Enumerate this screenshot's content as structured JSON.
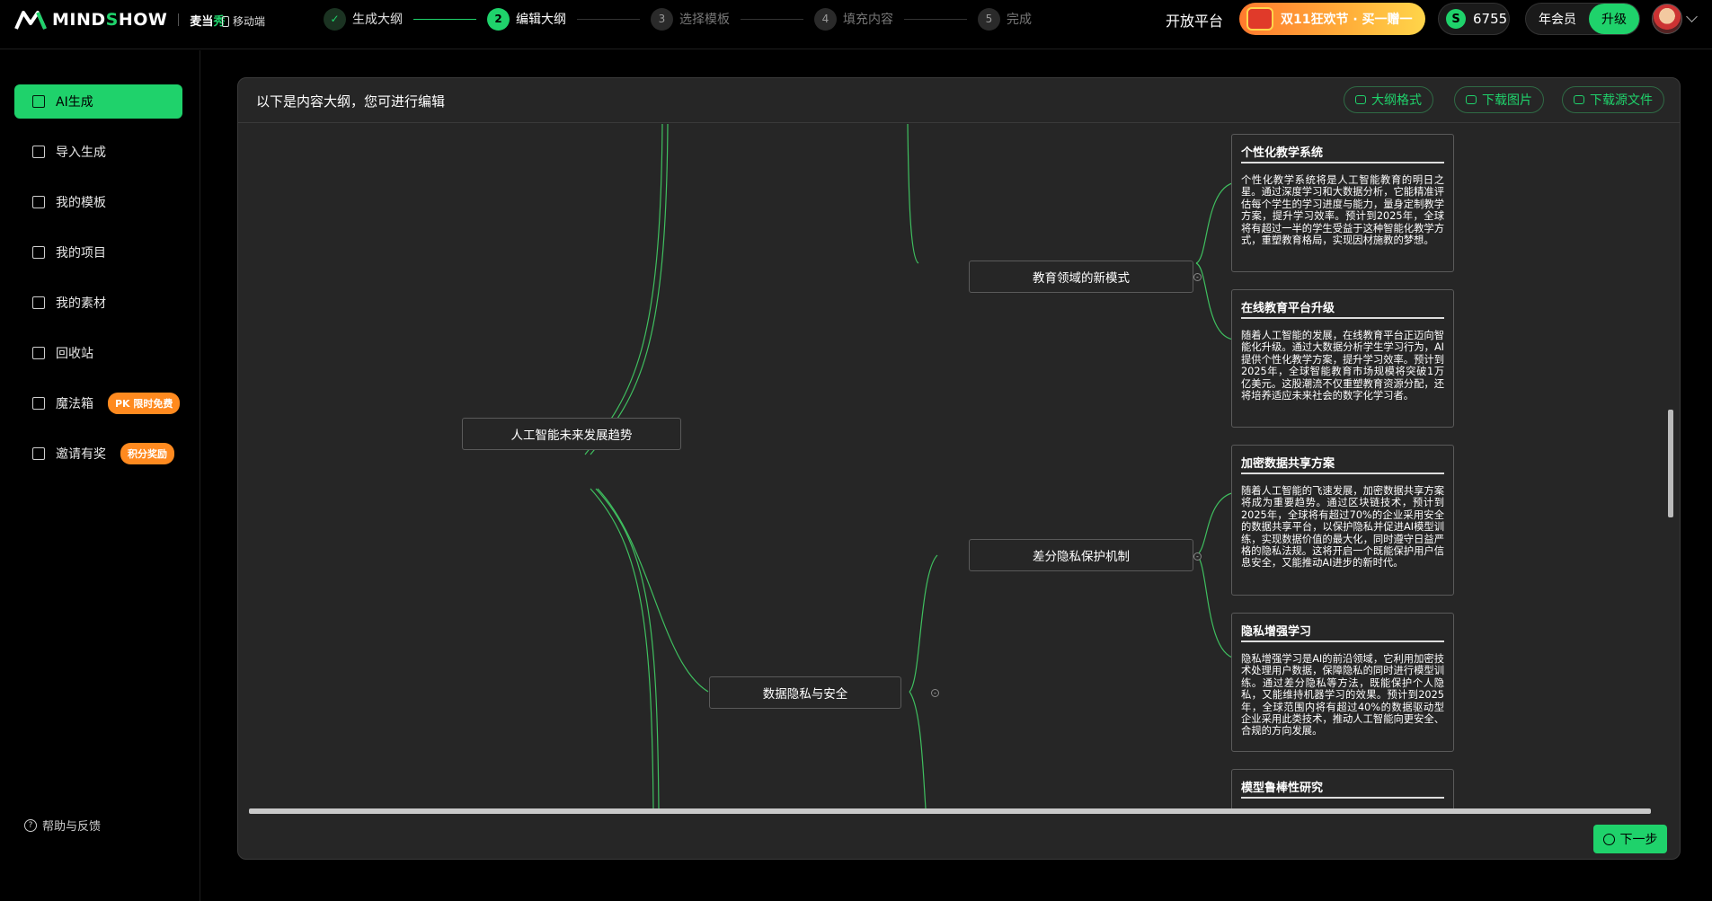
{
  "brand": {
    "logo_text_prefix": "MIND",
    "logo_text_s": "S",
    "logo_text_suffix": "HOW",
    "partner_a": "麦当",
    "partner_b": "秀",
    "mobile": "移动端"
  },
  "steps": [
    {
      "num": "✓",
      "label": "生成大纲",
      "state": "done"
    },
    {
      "num": "2",
      "label": "编辑大纲",
      "state": "active"
    },
    {
      "num": "3",
      "label": "选择模板",
      "state": "todo"
    },
    {
      "num": "4",
      "label": "填充内容",
      "state": "todo"
    },
    {
      "num": "5",
      "label": "完成",
      "state": "todo"
    }
  ],
  "header": {
    "open_platform": "开放平台",
    "promo": "双11狂欢节 · 买一赠一",
    "coin_symbol": "S",
    "coins": "6755",
    "member_label": "年会员",
    "upgrade": "升级"
  },
  "sidebar": {
    "items": [
      {
        "label": "AI生成",
        "icon": "ai-icon",
        "active": true
      },
      {
        "label": "导入生成",
        "icon": "import-icon"
      },
      {
        "label": "我的模板",
        "icon": "template-icon"
      },
      {
        "label": "我的项目",
        "icon": "list-icon"
      },
      {
        "label": "我的素材",
        "icon": "folder-icon"
      },
      {
        "label": "回收站",
        "icon": "trash-icon"
      },
      {
        "label": "魔法箱",
        "icon": "magic-wand-icon",
        "badge": "PK 限时免费"
      },
      {
        "label": "邀请有奖",
        "icon": "invite-icon",
        "badge": "积分奖励"
      }
    ],
    "help": "帮助与反馈"
  },
  "panel": {
    "title": "以下是内容大纲，您可进行编辑",
    "outline_format": "大纲格式",
    "download_image": "下载图片",
    "download_source": "下载源文件",
    "next": "下一步"
  },
  "mindmap": {
    "root": "人工智能未来发展趋势",
    "branch": "数据隐私与安全",
    "sub_edu": "教育领域的新模式",
    "sub_privacy": "差分隐私保护机制",
    "cards": [
      {
        "title": "个性化教学系统",
        "body": "个性化教学系统将是人工智能教育的明日之星。通过深度学习和大数据分析，它能精准评估每个学生的学习进度与能力，量身定制教学方案，提升学习效率。预计到2025年，全球将有超过一半的学生受益于这种智能化教学方式，重塑教育格局，实现因材施教的梦想。"
      },
      {
        "title": "在线教育平台升级",
        "body": "随着人工智能的发展，在线教育平台正迈向智能化升级。通过大数据分析学生学习行为，AI提供个性化教学方案，提升学习效率。预计到2025年，全球智能教育市场规模将突破1万亿美元。这股潮流不仅重塑教育资源分配，还将培养适应未来社会的数字化学习者。"
      },
      {
        "title": "加密数据共享方案",
        "body": "随着人工智能的飞速发展，加密数据共享方案将成为重要趋势。通过区块链技术，预计到2025年，全球将有超过70%的企业采用安全的数据共享平台，以保护隐私并促进AI模型训练，实现数据价值的最大化，同时遵守日益严格的隐私法规。这将开启一个既能保护用户信息安全，又能推动AI进步的新时代。"
      },
      {
        "title": "隐私增强学习",
        "body": "隐私增强学习是AI的前沿领域，它利用加密技术处理用户数据，保障隐私的同时进行模型训练。通过差分隐私等方法，既能保护个人隐私，又能维持机器学习的效果。预计到2025年，全球范围内将有超过40%的数据驱动型企业采用此类技术，推动人工智能向更安全、合规的方向发展。"
      },
      {
        "title": "模型鲁棒性研究",
        "body": ""
      }
    ]
  },
  "colors": {
    "accent": "#1fd26b",
    "badge": "#ff8a1f",
    "panel_bg": "#262626",
    "line": "#3fbf5f"
  }
}
